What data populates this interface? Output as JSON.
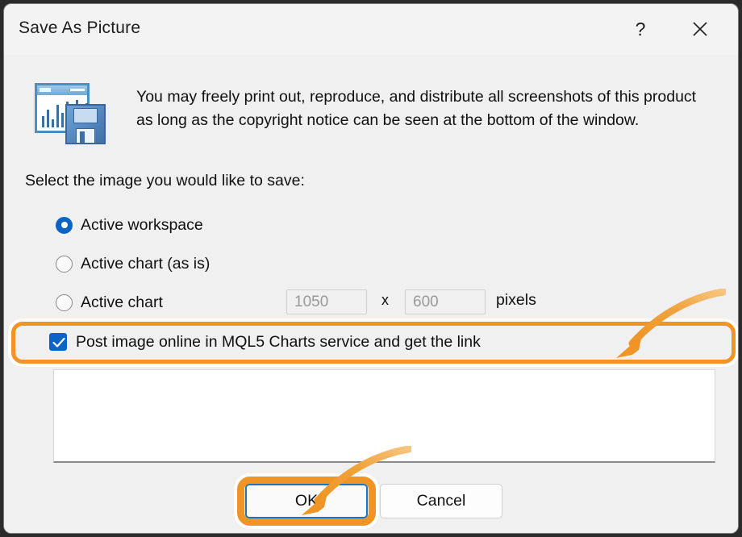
{
  "window": {
    "title": "Save As Picture",
    "help_icon": "question-mark-icon",
    "close_icon": "close-icon",
    "app_icon": "chart-save-icon"
  },
  "description": "You may freely print out, reproduce, and distribute all screenshots of this product as long as the copyright notice can be seen at the bottom of the window.",
  "select_label": "Select the image you would like to save:",
  "radio_options": [
    {
      "label": "Active workspace",
      "checked": true
    },
    {
      "label": "Active chart (as is)",
      "checked": false
    },
    {
      "label": "Active chart",
      "checked": false
    }
  ],
  "size": {
    "width_value": "1050",
    "separator": "x",
    "height_value": "600",
    "unit": "pixels",
    "enabled": false
  },
  "post_online": {
    "label": "Post image online in MQL5 Charts service and get the link",
    "checked": true,
    "check_icon": "checkmark-icon"
  },
  "link_panel": {
    "value": ""
  },
  "buttons": {
    "ok": "OK",
    "cancel": "Cancel"
  },
  "annotations": {
    "highlight_color": "#ef9425",
    "arrow_checkbox": "curved-arrow-icon",
    "arrow_ok": "curved-arrow-icon"
  },
  "colors": {
    "accent_blue": "#0a64c8",
    "highlight_orange": "#ef9425",
    "dialog_background": "#f0f0f0",
    "titlebar_background": "#f3f3f3"
  }
}
